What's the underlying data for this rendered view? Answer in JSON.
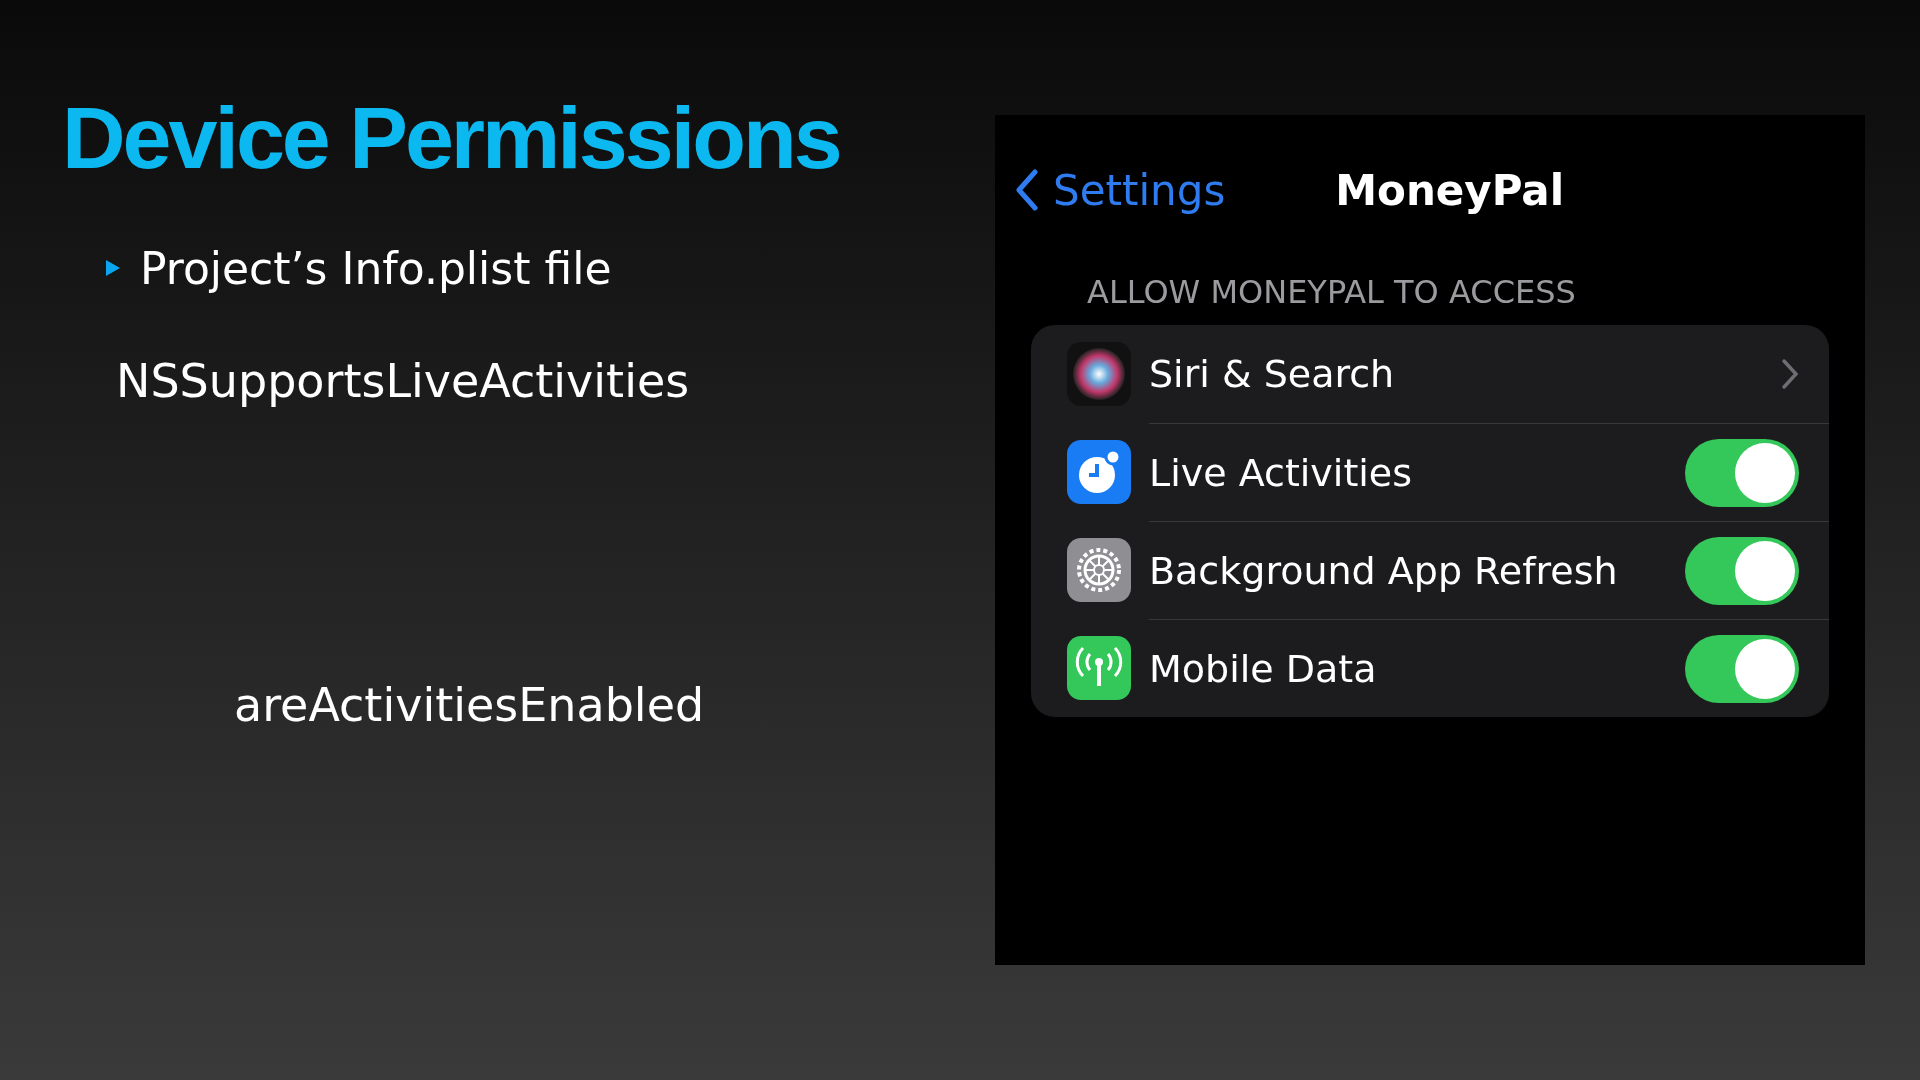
{
  "slide": {
    "title": "Device Permissions",
    "bullets": [
      "Project’s Info.plist file"
    ],
    "code_terms": [
      "NSSupportsLiveActivities",
      "areActivitiesEnabled"
    ]
  },
  "phone": {
    "back_label": "Settings",
    "title": "MoneyPal",
    "section_header": "ALLOW MONEYPAL TO ACCESS",
    "rows": [
      {
        "kind": "link",
        "label": "Siri & Search"
      },
      {
        "kind": "toggle",
        "label": "Live Activities",
        "on": true
      },
      {
        "kind": "toggle",
        "label": "Background App Refresh",
        "on": true
      },
      {
        "kind": "toggle",
        "label": "Mobile Data",
        "on": true
      }
    ]
  }
}
